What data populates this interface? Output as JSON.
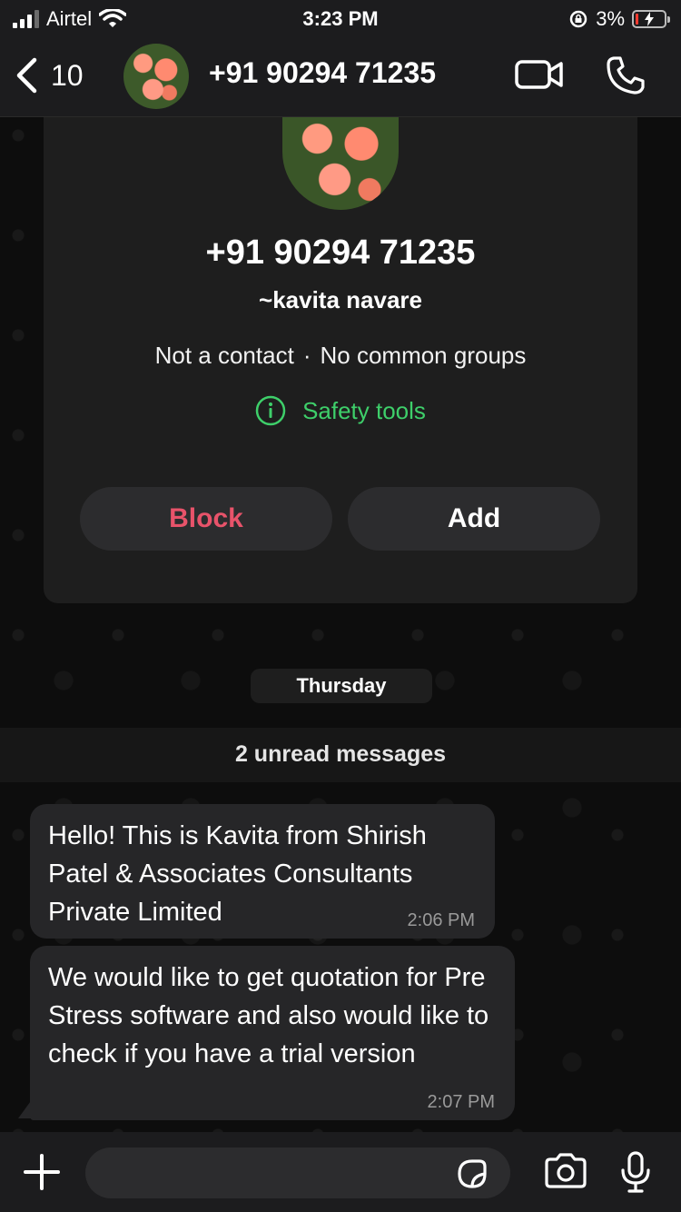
{
  "status_bar": {
    "carrier": "Airtel",
    "time": "3:23 PM",
    "battery_percent": "3%"
  },
  "header": {
    "back_count": "10",
    "title": "+91 90294 71235"
  },
  "contact_card": {
    "phone": "+91 90294 71235",
    "name": "~kavita navare",
    "not_contact": "Not a contact",
    "groups": "No common groups",
    "separator": "·",
    "safety_label": "Safety tools",
    "block_label": "Block",
    "add_label": "Add"
  },
  "chat": {
    "date_label": "Thursday",
    "unread_label": "2 unread messages",
    "messages": [
      {
        "text": "Hello! This is Kavita from Shirish Patel & Associates Consultants Private Limited",
        "time": "2:06 PM"
      },
      {
        "text": "We would like to get quotation for Pre Stress  software and also would like to check if you have a trial version",
        "time": "2:07 PM"
      }
    ]
  },
  "input_bar": {
    "placeholder": ""
  },
  "colors": {
    "accent_green": "#3ecf6a",
    "block_red": "#e8536a",
    "bubble": "#262628"
  }
}
